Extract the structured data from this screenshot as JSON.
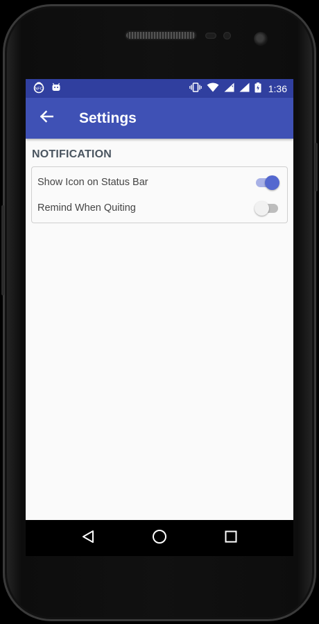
{
  "status_bar": {
    "time": "1:36",
    "left_icons": [
      "nfc-icon",
      "android-icon"
    ],
    "right_icons": [
      "vibrate-icon",
      "wifi-icon",
      "signal-icon",
      "signal-icon",
      "battery-icon"
    ]
  },
  "app_bar": {
    "title": "Settings",
    "back_icon": "arrow-back-icon"
  },
  "section": {
    "title": "NOTIFICATION"
  },
  "settings": [
    {
      "label": "Show Icon on Status Bar",
      "enabled": true
    },
    {
      "label": "Remind When Quiting",
      "enabled": false
    }
  ],
  "nav_bar": {
    "buttons": [
      "back-triangle-icon",
      "home-circle-icon",
      "recents-square-icon"
    ]
  },
  "colors": {
    "status_bar": "#303f9f",
    "app_bar": "#3f51b5",
    "switch_on_thumb": "#5468cf",
    "switch_on_track": "#a8b1e6",
    "switch_off_thumb": "#f1f1f1",
    "switch_off_track": "#bdbdbd"
  }
}
